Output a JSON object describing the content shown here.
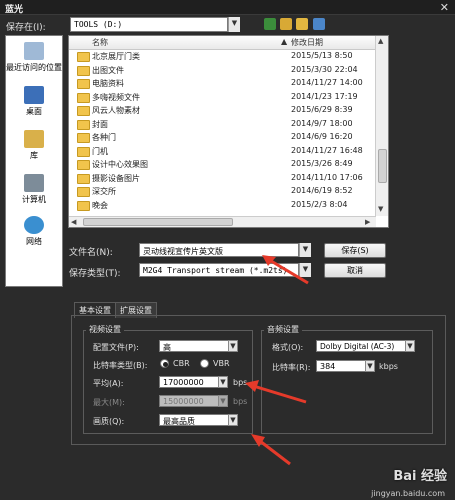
{
  "window": {
    "title": "蓝光",
    "close": "✕"
  },
  "save_in": {
    "label": "保存在(I):",
    "value": "TOOLS (D:)"
  },
  "places": [
    {
      "label": "最近访问的位置"
    },
    {
      "label": "桌面"
    },
    {
      "label": "库"
    },
    {
      "label": "计算机"
    },
    {
      "label": "网络"
    }
  ],
  "file_list": {
    "columns": {
      "name": "名称",
      "modified": "修改日期"
    },
    "rows": [
      {
        "name": "北京展厅门类",
        "date": "2015/5/13 8:50"
      },
      {
        "name": "出图文件",
        "date": "2015/3/30 22:04"
      },
      {
        "name": "电脑资料",
        "date": "2014/11/27 14:00"
      },
      {
        "name": "多嗨视频文件",
        "date": "2014/1/23 17:19"
      },
      {
        "name": "风云人物素材",
        "date": "2015/6/29 8:39"
      },
      {
        "name": "封面",
        "date": "2014/9/7 18:00"
      },
      {
        "name": "各种门",
        "date": "2014/6/9 16:20"
      },
      {
        "name": "门机",
        "date": "2014/11/27 16:48"
      },
      {
        "name": "设计中心效果图",
        "date": "2015/3/26 8:49"
      },
      {
        "name": "摄影设备图片",
        "date": "2014/11/10 17:06"
      },
      {
        "name": "深交所",
        "date": "2014/6/19 8:52"
      },
      {
        "name": "晚会",
        "date": "2015/2/3 8:04"
      }
    ]
  },
  "filename": {
    "label": "文件名(N):",
    "value": "灵动线视宣传片英文版"
  },
  "filetype": {
    "label": "保存类型(T):",
    "value": "M2G4 Transport stream (*.m2ts)"
  },
  "buttons": {
    "save": "保存(S)",
    "cancel": "取消"
  },
  "tabs": {
    "basic": "基本设置",
    "advanced": "扩展设置"
  },
  "video": {
    "group_title": "视频设置",
    "profile_label": "配置文件(P):",
    "profile_value": "高",
    "bitrate_type_label": "比特率类型(B):",
    "cbr": "CBR",
    "vbr": "VBR",
    "avg_label": "平均(A):",
    "avg_value": "17000000",
    "avg_unit": "bps",
    "max_label": "最大(M):",
    "max_value": "15000000",
    "max_unit": "bps",
    "quality_label": "画质(Q):",
    "quality_value": "最高品质"
  },
  "audio": {
    "group_title": "音频设置",
    "format_label": "格式(O):",
    "format_value": "Dolby Digital (AC-3)",
    "bitrate_label": "比特率(R):",
    "bitrate_value": "384",
    "bitrate_unit": "kbps"
  },
  "watermark": {
    "logo": "Bai 经验",
    "url": "jingyan.baidu.com"
  }
}
